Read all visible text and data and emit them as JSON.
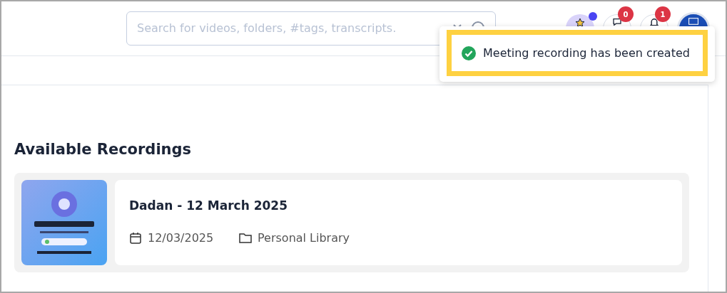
{
  "search": {
    "placeholder": "Search for videos, folders, #tags, transcripts."
  },
  "header_buttons": [
    {
      "kind": "star"
    },
    {
      "kind": "chat",
      "badge": "0"
    },
    {
      "kind": "bell",
      "badge": "1"
    },
    {
      "kind": "avatar"
    }
  ],
  "toast": {
    "message": "Meeting recording has been created",
    "highlighted": true
  },
  "section_title": "Available Recordings",
  "recordings": [
    {
      "title": "Dadan - 12 March 2025",
      "date": "12/03/2025",
      "folder": "Personal Library"
    }
  ]
}
